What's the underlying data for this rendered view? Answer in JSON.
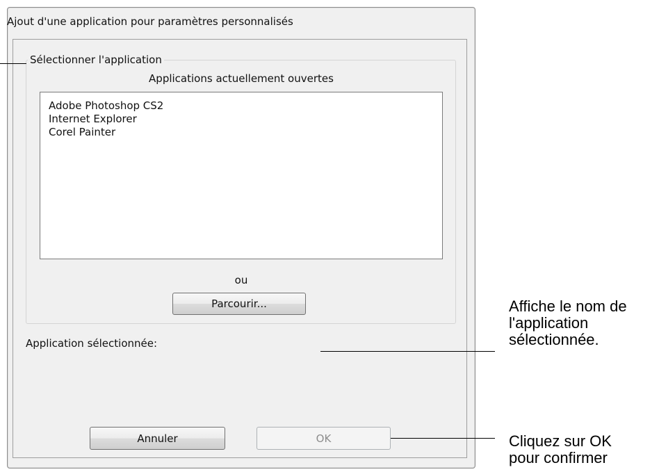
{
  "dialog": {
    "title": "Ajout d'une application pour paramètres personnalisés",
    "group_label": "Sélectionner l'application",
    "list_caption": "Applications actuellement ouvertes",
    "applications": [
      "Adobe Photoshop CS2",
      "Internet Explorer",
      "Corel Painter"
    ],
    "or_label": "ou",
    "browse_label": "Parcourir...",
    "selected_label": "Application sélectionnée:",
    "selected_value": "",
    "cancel_label": "Annuler",
    "ok_label": "OK"
  },
  "annotations": {
    "name_note": [
      "Affiche le nom de",
      "l'application",
      "sélectionnée."
    ],
    "ok_note": [
      "Cliquez sur OK",
      "pour confirmer"
    ]
  }
}
